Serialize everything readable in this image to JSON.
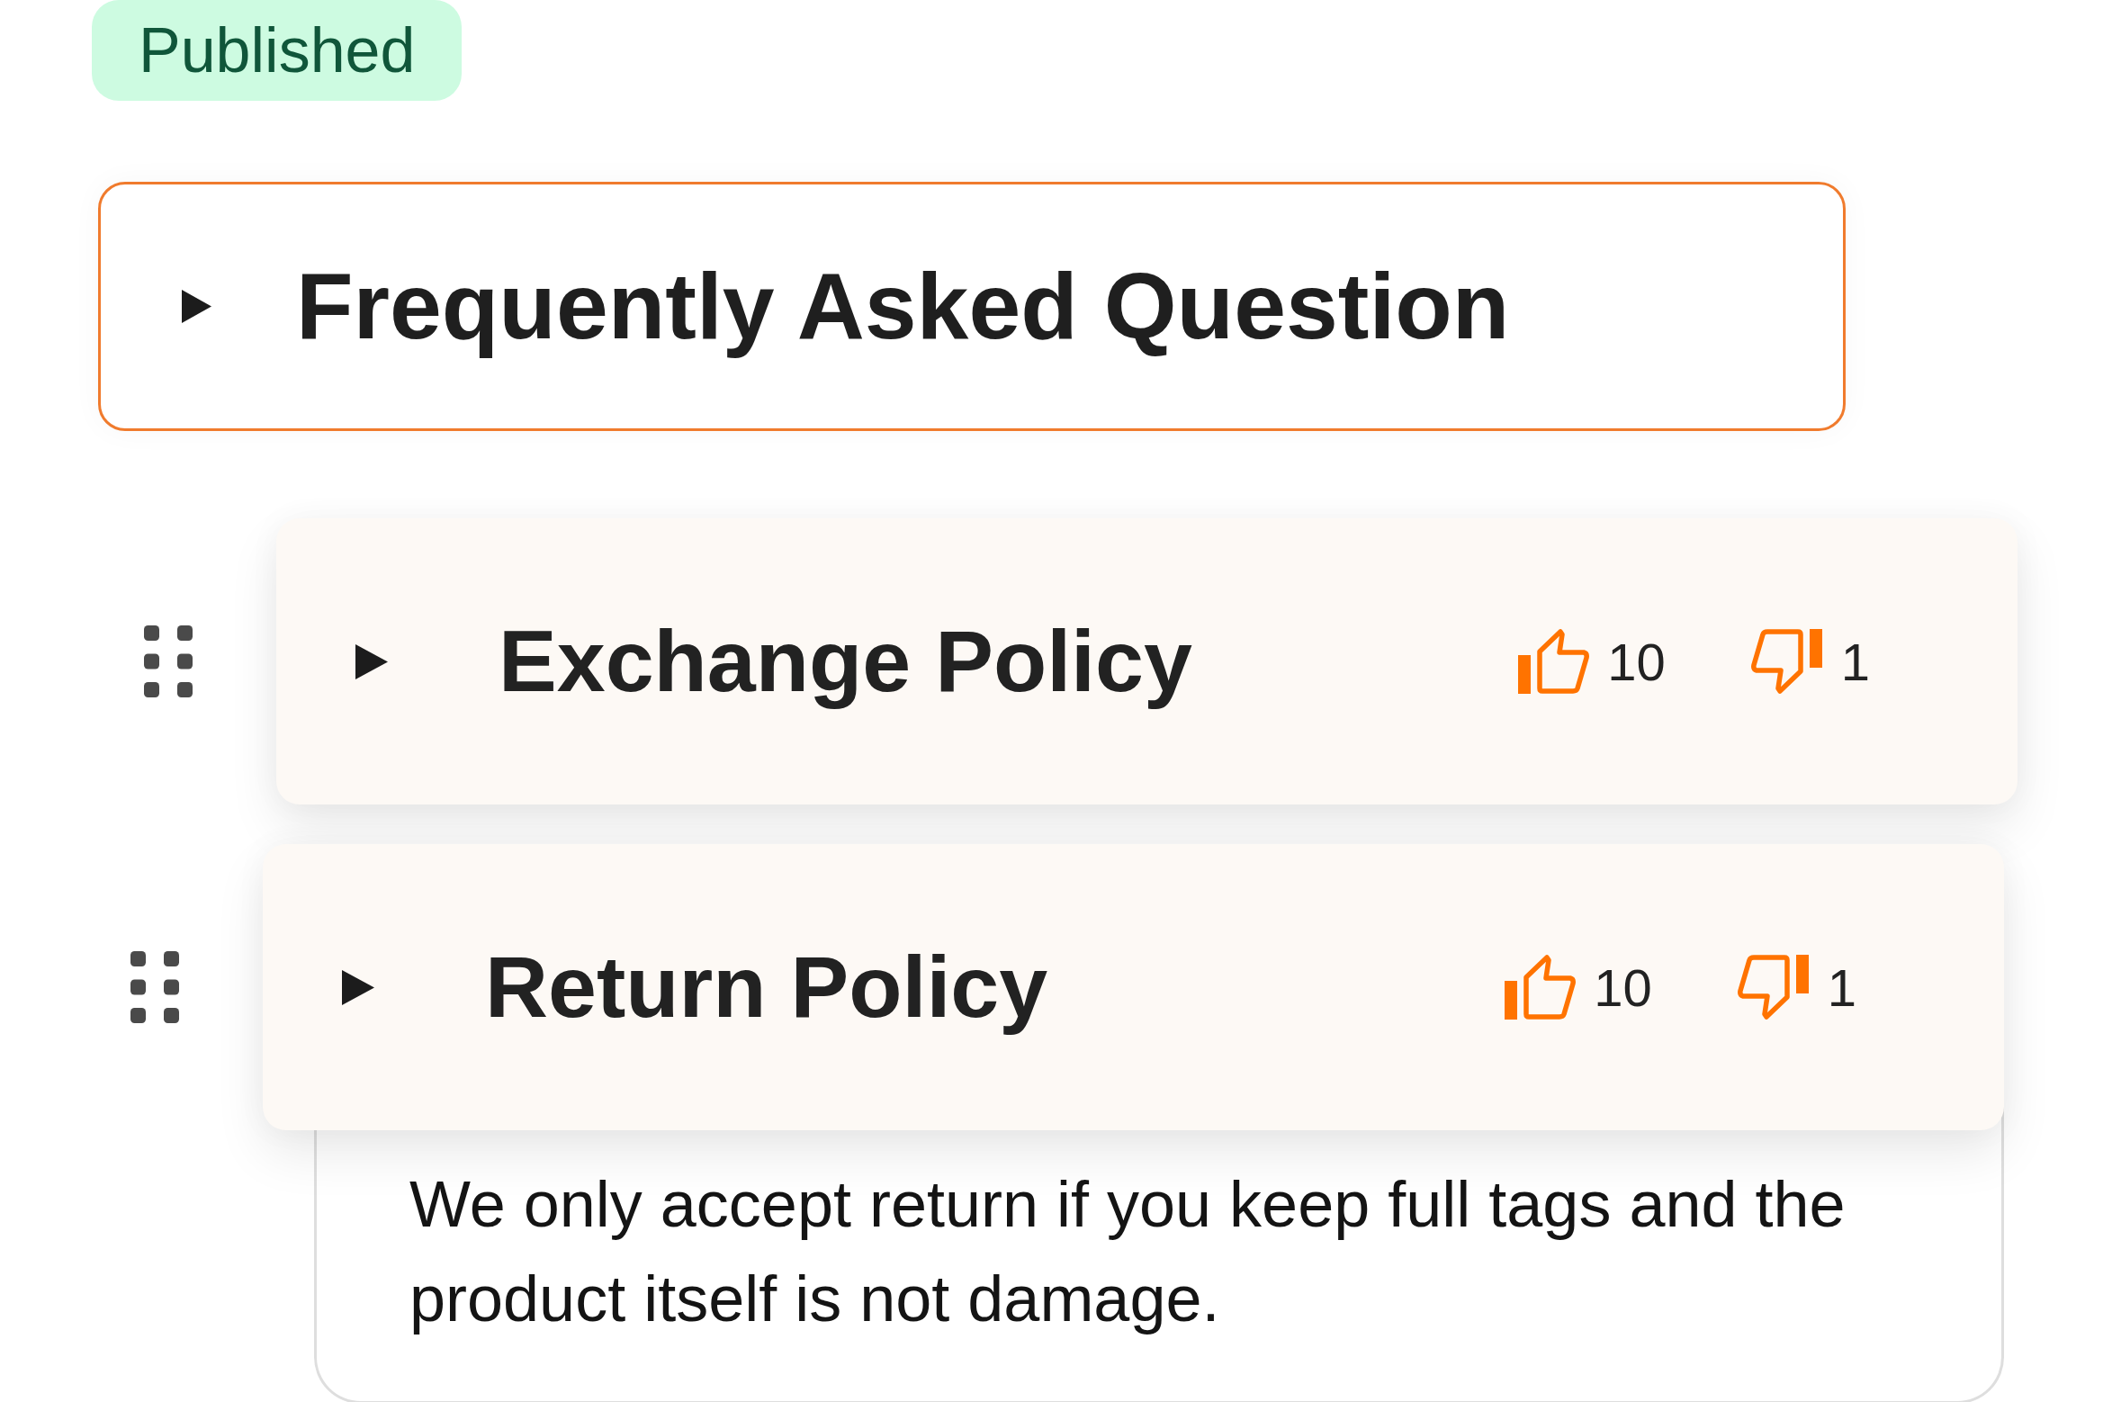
{
  "status_badge": {
    "label": "Published"
  },
  "faq_header": {
    "title": "Frequently Asked Question",
    "focused": true
  },
  "items": [
    {
      "title": "Exchange Policy",
      "likes": "10",
      "dislikes": "1"
    },
    {
      "title": "Return Policy",
      "likes": "10",
      "dislikes": "1",
      "answer": "We only accept return if you keep full tags and the product itself is not damage."
    }
  ]
}
